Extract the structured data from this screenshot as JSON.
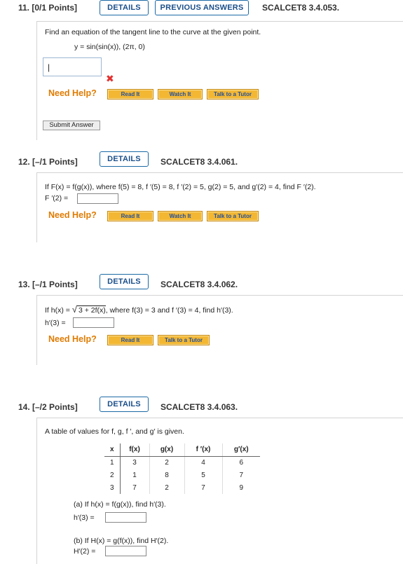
{
  "buttons": {
    "details": "DETAILS",
    "previous_answers": "PREVIOUS ANSWERS",
    "submit": "Submit Answer"
  },
  "help": {
    "need_help": "Need Help?",
    "read_it": "Read It",
    "watch_it": "Watch It",
    "talk_to_tutor": "Talk to a Tutor"
  },
  "q11": {
    "number": "11. [0/1 Points]",
    "code": "SCALCET8 3.4.053.",
    "prompt": "Find an equation of the tangent line to the curve at the given point.",
    "equation": "y = sin(sin(x)),  (2π, 0)",
    "answer_value": "|",
    "status": "✖"
  },
  "q12": {
    "number": "12. [–/1 Points]",
    "code": "SCALCET8 3.4.061.",
    "prompt": "If  F(x) = f(g(x)),  where  f(5) = 8,  f ′(5) = 8,  f ′(2) = 5,  g(2) = 5,  and  g′(2) = 4,  find  F ′(2).",
    "answer_label": "F ′(2) ="
  },
  "q13": {
    "number": "13. [–/1 Points]",
    "code": "SCALCET8 3.4.062.",
    "prompt_prefix": "If  h(x) = ",
    "sqrt_content": "3 + 2f(x)",
    "prompt_suffix": ",  where  f(3) = 3  and  f ′(3) = 4,  find  h′(3).",
    "answer_label": "h′(3) ="
  },
  "q14": {
    "number": "14. [–/2 Points]",
    "code": "SCALCET8 3.4.063.",
    "prompt": "A table of values for  f, g, f ′, and g′ is given.",
    "table": {
      "headers": [
        "x",
        "f(x)",
        "g(x)",
        "f ′(x)",
        "g′(x)"
      ],
      "rows": [
        [
          "1",
          "3",
          "2",
          "4",
          "6"
        ],
        [
          "2",
          "1",
          "8",
          "5",
          "7"
        ],
        [
          "3",
          "7",
          "2",
          "7",
          "9"
        ]
      ]
    },
    "part_a": "(a) If  h(x) = f(g(x)),  find  h′(3).",
    "part_a_label": "h′(3) =",
    "part_b": "(b) If  H(x) = g(f(x)),  find  H′(2).",
    "part_b_label": "H′(2) ="
  }
}
